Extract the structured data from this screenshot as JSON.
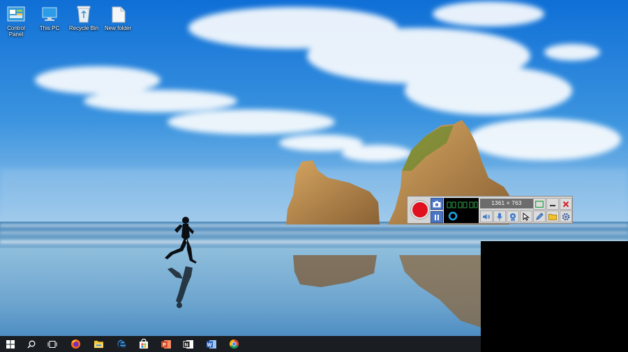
{
  "desktop": {
    "icons": [
      {
        "label": "Control Panel",
        "icon": "control-panel-icon"
      },
      {
        "label": "This PC",
        "icon": "computer-icon"
      },
      {
        "label": "Recycle Bin",
        "icon": "recycle-bin-icon"
      },
      {
        "label": "New folder",
        "icon": "folder-icon"
      }
    ],
    "wallpaper": "beach-rocks-runner"
  },
  "recorder": {
    "resolution": "1361 × 763",
    "colors": {
      "record": "#e0101e",
      "accent": "#4a74c4",
      "body": "#d4d4d4"
    },
    "buttons": [
      "record-button",
      "camera-icon",
      "pause-button",
      "webcam-icon",
      "speaker-icon",
      "microphone-icon",
      "webcam-small-icon",
      "cursor-icon",
      "pen-icon",
      "folder-icon",
      "settings-icon",
      "window-mode-icon",
      "minimize-icon",
      "close-icon"
    ]
  },
  "taskbar": {
    "items": [
      "windows-start-icon",
      "search-icon",
      "task-view-icon",
      "firefox-icon",
      "file-explorer-icon",
      "edge-icon",
      "store-icon",
      "powerpoint-icon",
      "onenote-icon",
      "word-icon",
      "chrome-icon"
    ]
  }
}
